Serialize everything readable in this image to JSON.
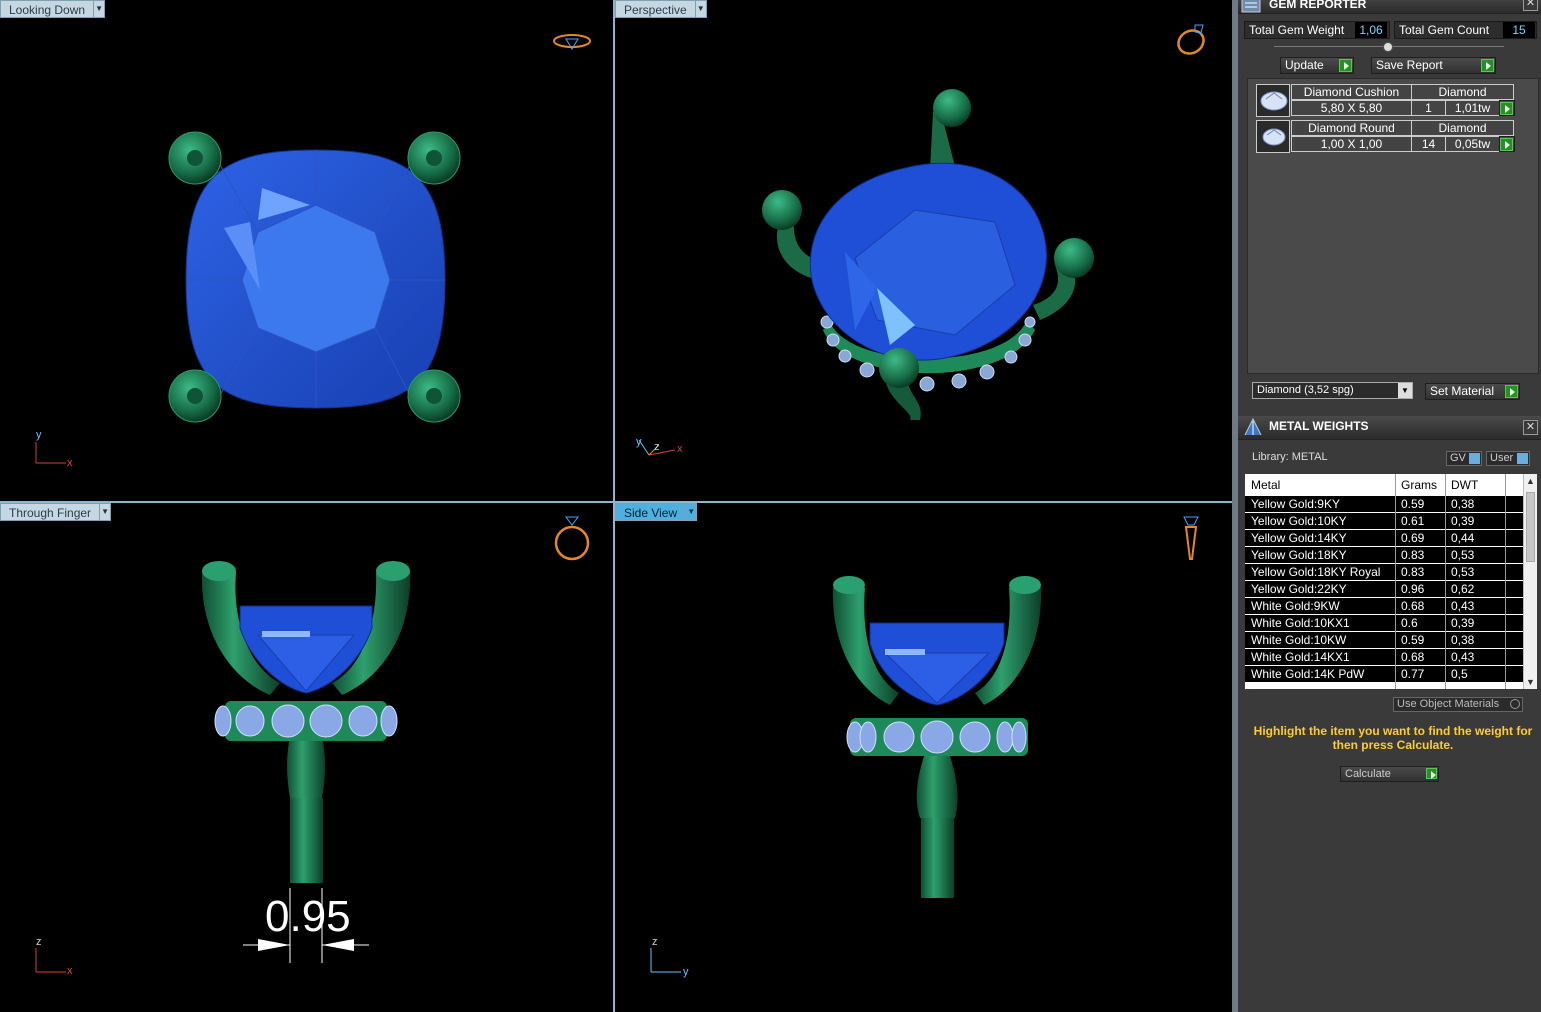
{
  "viewports": {
    "top_left": {
      "label": "Looking Down",
      "axis_v": "y",
      "axis_h": "x"
    },
    "top_right": {
      "label": "Perspective",
      "axis_1": "y",
      "axis_2": "z",
      "axis_3": "x"
    },
    "bottom_left": {
      "label": "Through Finger",
      "axis_v": "z",
      "axis_h": "x",
      "dimension": "0.95"
    },
    "bottom_right": {
      "label": "Side View",
      "axis_v": "z",
      "axis_h": "y"
    }
  },
  "gem_reporter": {
    "title": "GEM REPORTER",
    "total_weight_label": "Total Gem Weight",
    "total_weight_value": "1,06",
    "total_count_label": "Total Gem Count",
    "total_count_value": "15",
    "update_label": "Update",
    "save_report_label": "Save Report",
    "gems": [
      {
        "name": "Diamond Cushion",
        "material": "Diamond",
        "size": "5,80 X 5,80",
        "count": "1",
        "weight": "1,01tw"
      },
      {
        "name": "Diamond Round",
        "material": "Diamond",
        "size": "1,00 X 1,00",
        "count": "14",
        "weight": "0,05tw"
      }
    ],
    "material_select": "Diamond    (3,52 spg)",
    "set_material_label": "Set Material"
  },
  "metal_weights": {
    "title": "METAL WEIGHTS",
    "library": "Library: METAL",
    "gv_label": "GV",
    "user_label": "User",
    "columns": [
      "Metal",
      "Grams",
      "DWT"
    ],
    "rows": [
      {
        "metal": "Yellow Gold:9KY",
        "grams": "0.59",
        "dwt": "0,38"
      },
      {
        "metal": "Yellow Gold:10KY",
        "grams": "0.61",
        "dwt": "0,39"
      },
      {
        "metal": "Yellow Gold:14KY",
        "grams": "0.69",
        "dwt": "0,44"
      },
      {
        "metal": "Yellow Gold:18KY",
        "grams": "0.83",
        "dwt": "0,53"
      },
      {
        "metal": "Yellow Gold:18KY Royal",
        "grams": "0.83",
        "dwt": "0,53"
      },
      {
        "metal": "Yellow Gold:22KY",
        "grams": "0.96",
        "dwt": "0,62"
      },
      {
        "metal": "White Gold:9KW",
        "grams": "0.68",
        "dwt": "0,43"
      },
      {
        "metal": "White Gold:10KX1",
        "grams": "0.6",
        "dwt": "0,39"
      },
      {
        "metal": "White Gold:10KW",
        "grams": "0.59",
        "dwt": "0,38"
      },
      {
        "metal": "White Gold:14KX1",
        "grams": "0.68",
        "dwt": "0,43"
      },
      {
        "metal": "White Gold:14K PdW",
        "grams": "0.77",
        "dwt": "0,5"
      }
    ],
    "use_object_materials": "Use Object Materials",
    "hint": "Highlight the item you want to find the weight for then press Calculate.",
    "calculate_label": "Calculate"
  },
  "colors": {
    "gem_blue": "#1f4fd6",
    "metal_green": "#1f7a52",
    "accent_dims": "#4fb0e0"
  }
}
